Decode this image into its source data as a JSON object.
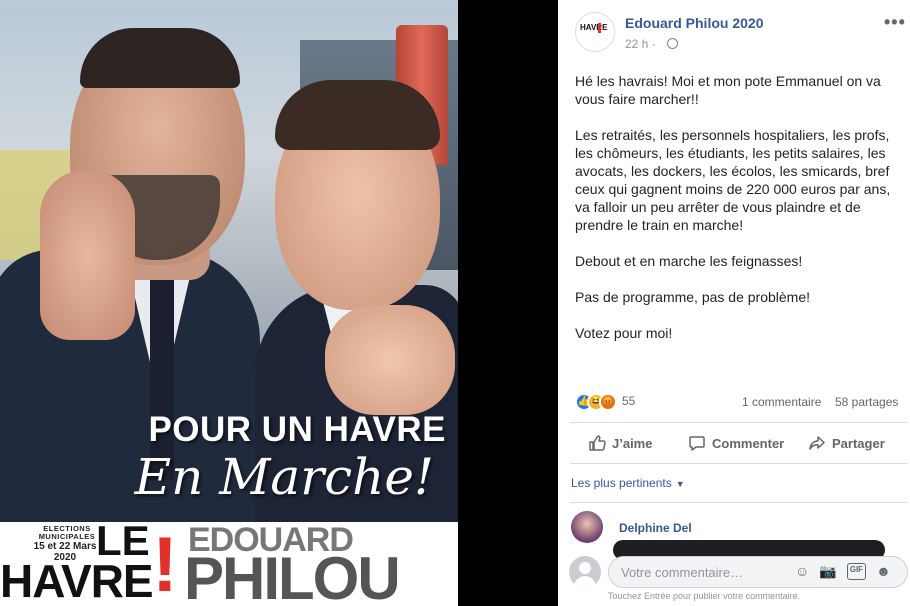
{
  "image": {
    "slogan_line1": "POUR UN HAVRE",
    "slogan_line2": "En Marche!",
    "elections_label": "ELECTIONS MUNICIPALES",
    "dates_line1": "15 et 22 Mars",
    "dates_line2": "2020",
    "le": "LE",
    "havre": "HAVRE",
    "exclamation": "!",
    "edouard": "EDOUARD",
    "philou": "PHILOU"
  },
  "post": {
    "page_name": "Edouard Philou 2020",
    "time": "22 h",
    "more_label": "•••",
    "avatar_text": "HAVRE",
    "paragraphs": [
      "Hé les havrais! Moi et mon pote Emmanuel on va vous faire marcher!!",
      "Les retraités, les personnels hospitaliers, les profs, les chômeurs, les étudiants, les petits salaires, les avocats, les dockers, les écolos, les smicards, bref ceux qui gagnent moins de 220 000 euros par ans, va falloir un peu arrêter de vous plaindre et de prendre le train en marche!",
      "Debout et en marche les feignasses!",
      "Pas de programme, pas de problème!",
      "Votez pour moi!"
    ],
    "reaction_count": "55",
    "comments_count": "1 commentaire",
    "shares_count": "58 partages"
  },
  "actions": {
    "like": "J’aime",
    "comment": "Commenter",
    "share": "Partager"
  },
  "comments": {
    "sort_label": "Les plus pertinents",
    "commenter_name": "Delphine Del",
    "input_placeholder": "Votre commentaire…",
    "hint": "Touchez Entrée pour publier votre commentaire."
  },
  "colors": {
    "link": "#365899",
    "like_blue": "#1877f2",
    "accent_red": "#e0322b"
  }
}
